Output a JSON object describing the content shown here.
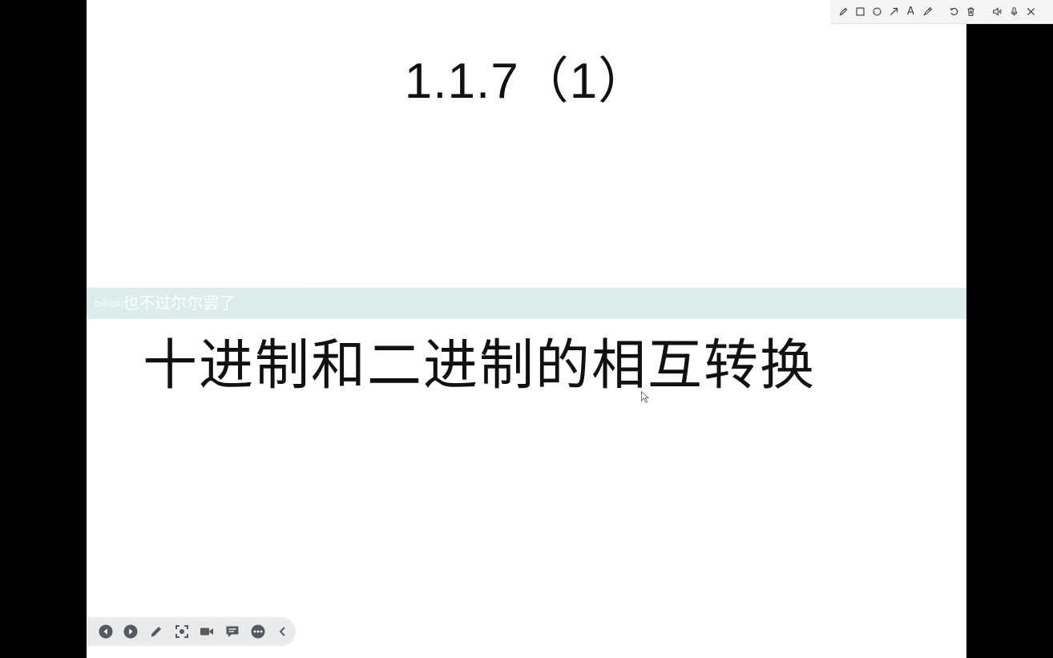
{
  "slide": {
    "title": "1.1.7（1）",
    "subtitle": "十进制和二进制的相互转换"
  },
  "danmaku": {
    "brand": "bilibili",
    "text": "也不过尔尔罢了"
  },
  "annotation_toolbar": {
    "tools": [
      {
        "name": "pen-icon"
      },
      {
        "name": "rectangle-icon"
      },
      {
        "name": "circle-icon"
      },
      {
        "name": "arrow-icon"
      },
      {
        "name": "text-tool",
        "label": "A"
      },
      {
        "name": "highlighter-icon"
      },
      {
        "name": "undo-icon"
      },
      {
        "name": "trash-icon"
      },
      {
        "name": "speaker-icon"
      },
      {
        "name": "microphone-icon"
      },
      {
        "name": "close-icon"
      }
    ]
  },
  "controls": {
    "buttons": [
      "previous-icon",
      "next-icon",
      "pen-icon",
      "screenshot-icon",
      "camera-icon",
      "chat-icon",
      "more-icon",
      "collapse-icon"
    ]
  },
  "colors": {
    "background": "#000000",
    "slide": "#ffffff",
    "danmaku_bar": "#d9ecec",
    "toolbar": "#f4f5f7",
    "control_pill": "#e9eaec",
    "icon_dark": "#3a3a3a",
    "control_icon": "#555a60"
  }
}
